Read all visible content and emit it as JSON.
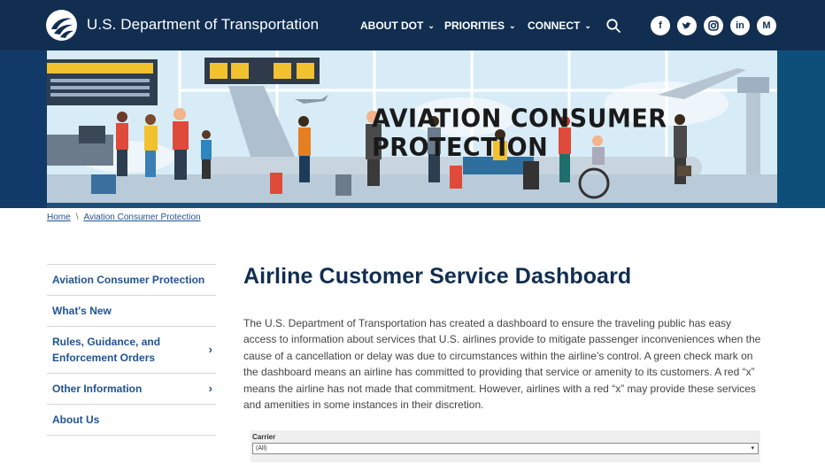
{
  "header": {
    "site_title": "U.S. Department of Transportation",
    "nav": [
      {
        "label": "ABOUT DOT"
      },
      {
        "label": "PRIORITIES"
      },
      {
        "label": "CONNECT"
      }
    ],
    "social": [
      {
        "name": "facebook-icon",
        "glyph": "f"
      },
      {
        "name": "twitter-icon",
        "glyph": "t"
      },
      {
        "name": "instagram-icon",
        "glyph": "◎"
      },
      {
        "name": "linkedin-icon",
        "glyph": "in"
      },
      {
        "name": "medium-icon",
        "glyph": "M"
      }
    ],
    "colors": {
      "bar": "#112e51",
      "link": "#205493"
    }
  },
  "banner": {
    "title": "AVIATION CONSUMER PROTECTION"
  },
  "breadcrumb": {
    "home": "Home",
    "separator": "\\",
    "current": "Aviation Consumer Protection"
  },
  "sidebar": {
    "items": [
      {
        "label": "Aviation Consumer Protection",
        "has_arrow": false
      },
      {
        "label": "What's New",
        "has_arrow": false
      },
      {
        "label": "Rules, Guidance, and Enforcement Orders",
        "has_arrow": true
      },
      {
        "label": "Other Information",
        "has_arrow": true
      },
      {
        "label": "About Us",
        "has_arrow": false
      }
    ]
  },
  "main": {
    "title": "Airline Customer Service Dashboard",
    "intro": "The U.S. Department of Transportation has created a dashboard to ensure the traveling public has easy access to information about services that U.S. airlines provide to mitigate passenger inconveniences when the cause of a cancellation or delay was due to circumstances within the airline’s control. A green check mark on the dashboard means an airline has committed to providing that service or amenity to its customers. A red “x” means the airline has not made that commitment. However, airlines with a red “x” may provide these services and amenities in some instances in their discretion."
  },
  "filter": {
    "label": "Carrier",
    "selected": "(All)"
  }
}
